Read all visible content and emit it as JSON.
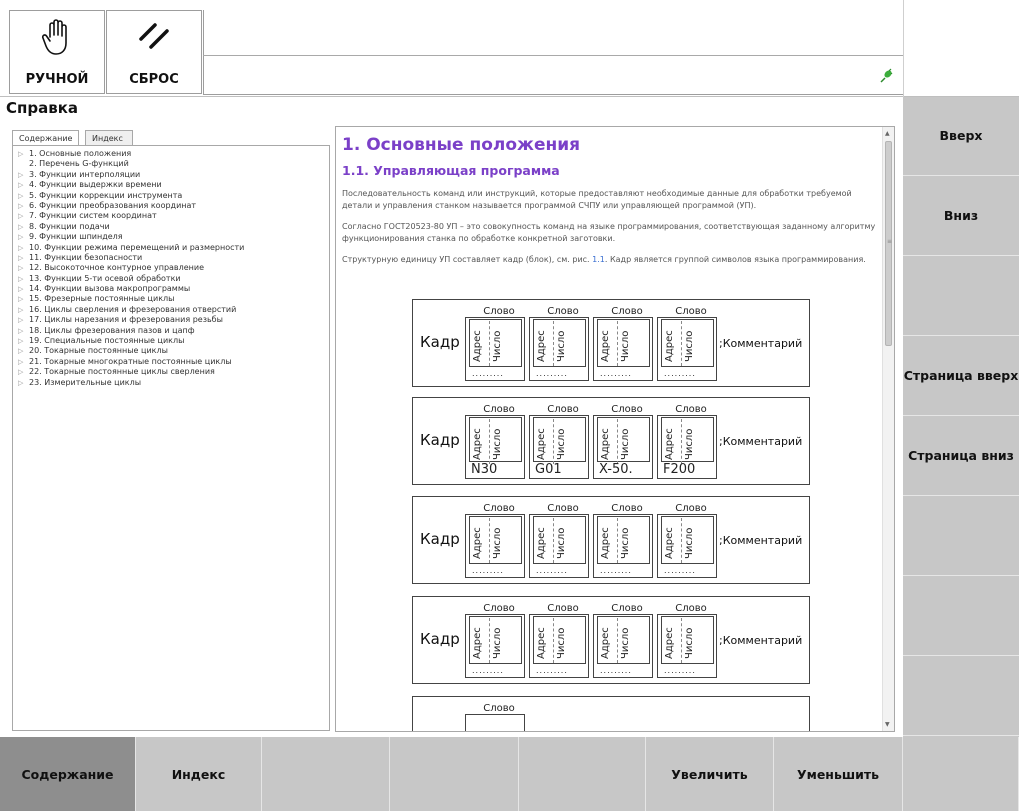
{
  "toolbar": {
    "manual_label": "РУЧНОЙ",
    "reset_label": "СБРОС"
  },
  "help": {
    "title": "Справка",
    "tabs": [
      "Содержание",
      "Индекс"
    ],
    "toc": [
      "1. Основные положения",
      "2. Перечень G-функций",
      "3. Функции интерполяции",
      "4. Функции выдержки времени",
      "5. Функции коррекции инструмента",
      "6. Функции преобразования координат",
      "7. Функции систем координат",
      "8. Функции подачи",
      "9. Функции шпинделя",
      "10. Функции режима перемещений и размерности",
      "11. Функции безопасности",
      "12. Высокоточное контурное управление",
      "13. Функции 5-ти осевой обработки",
      "14. Функции вызова макропрограммы",
      "15. Фрезерные постоянные циклы",
      "16. Циклы сверления и фрезерования отверстий",
      "17. Циклы нарезания и фрезерования резьбы",
      "18. Циклы фрезерования пазов и цапф",
      "19. Специальные постоянные циклы",
      "20. Токарные постоянные циклы",
      "21. Токарные многократные постоянные циклы",
      "22. Токарные постоянные циклы сверления",
      "23. Измерительные циклы"
    ],
    "doc": {
      "h1": "1. Основные положения",
      "h2": "1.1. Управляющая программа",
      "p1": "Последовательность команд или инструкций, которые предоставляют необходимые данные для обработки требуемой детали и управления станком называется программой СЧПУ или управляющей программой (УП).",
      "p2": "Согласно ГОСТ20523-80 УП – это совокупность команд на языке программирования, соответствующая заданному алгоритму функционирования станка по обработке конкретной заготовки.",
      "p3_a": "Структурную единицу УП составляет кадр (блок), см. рис. ",
      "p3_link": "1.1",
      "p3_b": ". Кадр является группой символов языка программирования."
    },
    "diagram": {
      "frame_label": "Кадр",
      "word_label": "Слово",
      "address_label": "Адрес",
      "number_label": "Число",
      "comment_label": ";Комментарий",
      "dots": ".........",
      "example_values": [
        "N30",
        "G01",
        "X-50.",
        "F200"
      ]
    }
  },
  "right_buttons": [
    "Вверх",
    "Вниз",
    "",
    "Страница вверх",
    "Страница вниз",
    "",
    "",
    ""
  ],
  "bottom_buttons": [
    "Содержание",
    "Индекс",
    "",
    "",
    "",
    "Увеличить",
    "Уменьшить",
    ""
  ]
}
